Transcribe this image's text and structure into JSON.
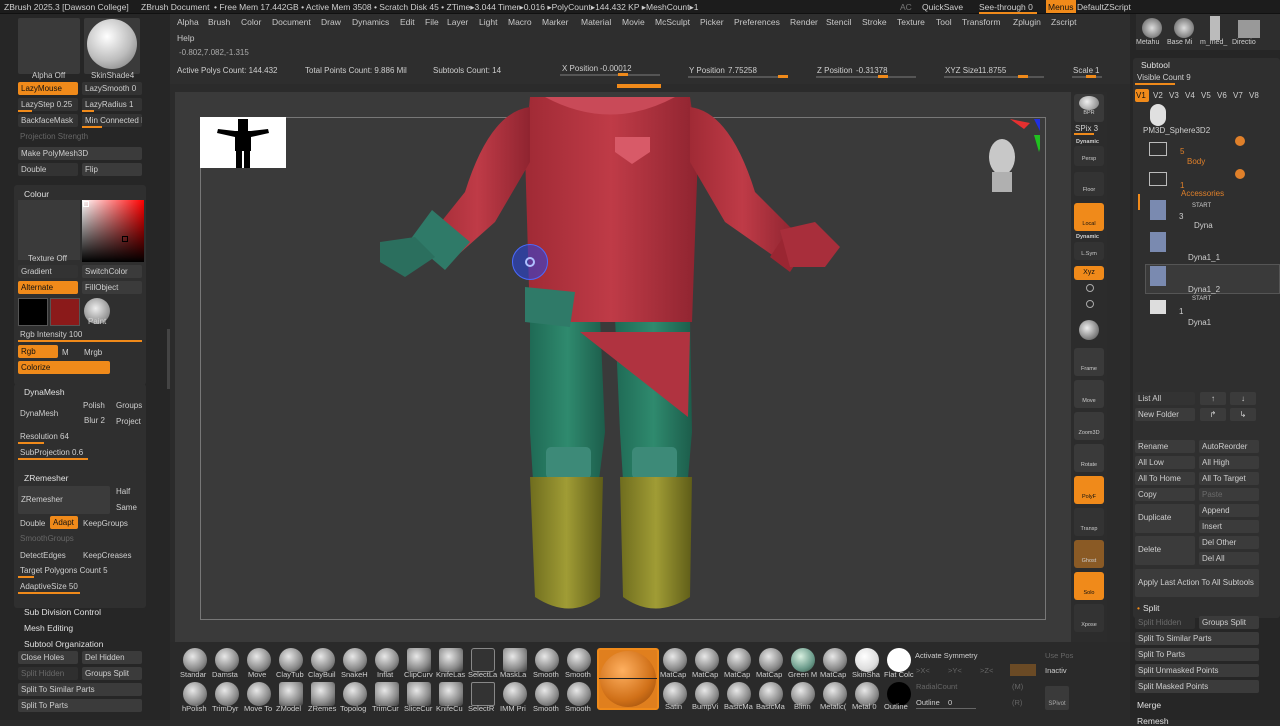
{
  "window": {
    "title": "ZBrush 2025.3 [Dawson College]",
    "document": "ZBrush Document",
    "status": "• Free Mem 17.442GB • Active Mem 3508 • Scratch Disk 45 • ZTime▸3.044 Timer▸0.016 ▸PolyCount▸144.432 KP ▸MeshCount▸1",
    "ac": "AC",
    "quicksave": "QuickSave",
    "see_through": "See-through  0",
    "menus": "Menus",
    "default_zscript": "DefaultZScript"
  },
  "menubar": {
    "items": [
      "Alpha",
      "Brush",
      "Color",
      "Document",
      "Draw",
      "Dynamics",
      "Edit",
      "File",
      "Layer",
      "Light",
      "Macro",
      "Marker",
      "Material",
      "Movie",
      "McSculpt",
      "Picker",
      "Preferences",
      "Render",
      "Stencil",
      "Stroke",
      "Texture",
      "Tool",
      "Transform",
      "Zplugin",
      "Zscript"
    ],
    "help": "Help",
    "coords": "-0.802,7.082,-1.315"
  },
  "infobar": {
    "active_polys": "Active Polys Count: 144.432",
    "total_points": "Total Points Count: 9.886 Mil",
    "subtools_count": "Subtools Count: 14",
    "x_label": "X Position",
    "x_value": "-0.00012",
    "y_label": "Y Position",
    "y_value": "7.75258",
    "z_label": "Z Position",
    "z_value": "-0.31378",
    "xyz_label": "XYZ Size",
    "xyz_value": "11.8755",
    "scale_label": "Scale",
    "scale_value": "1"
  },
  "left": {
    "alpha_off": "Alpha Off",
    "skinshade": "SkinShade4",
    "lazymouse": "LazyMouse",
    "lazysmooth": "LazySmooth 0",
    "lazystep": "LazyStep 0.25",
    "lazyradius": "LazyRadius 1",
    "backface": "BackfaceMask",
    "min_connected": "Min Connected I",
    "projection_strength": "Projection Strength",
    "make_polymesh": "Make PolyMesh3D",
    "double": "Double",
    "flip": "Flip",
    "colour": "Colour",
    "texture_off": "Texture Off",
    "gradient": "Gradient",
    "switchcolor": "SwitchColor",
    "alternate": "Alternate",
    "fillobject": "FillObject",
    "paint": "Paint",
    "rgb_intensity": "Rgb Intensity 100",
    "rgb": "Rgb",
    "m": "M",
    "mrgb": "Mrgb",
    "colorize": "Colorize",
    "dynamesh_hdr": "DynaMesh",
    "dynamesh_btn": "DynaMesh",
    "polish": "Polish",
    "groups": "Groups",
    "blur": "Blur 2",
    "project": "Project",
    "resolution": "Resolution 64",
    "subprojection": "SubProjection 0.6",
    "zremesher_hdr": "ZRemesher",
    "zremesher_btn": "ZRemesher",
    "half": "Half",
    "same": "Same",
    "double2": "Double",
    "adapt": "Adapt",
    "keepgroups": "KeepGroups",
    "smoothgroups": "SmoothGroups",
    "detectedges": "DetectEdges",
    "keepcreases": "KeepCreases",
    "target_polys": "Target Polygons Count 5",
    "adaptivesize": "AdaptiveSize 50",
    "subdiv_control": "Sub Division Control",
    "mesh_editing": "Mesh Editing",
    "subtool_org": "Subtool Organization",
    "close_holes": "Close Holes",
    "del_hidden": "Del Hidden",
    "split_hidden": "Split Hidden",
    "groups_split": "Groups Split",
    "split_similar": "Split To Similar Parts",
    "split_parts": "Split To Parts"
  },
  "colors": {
    "accent": "#f08a1a",
    "main_color": "#000000",
    "secondary_color": "#8b1a1a",
    "shirt": "#b8323f",
    "teal": "#2e7a68",
    "olive": "#8f8d2c"
  },
  "view_buttons": [
    "BPR",
    "SPix 3",
    "Dynamic",
    "Persp",
    "Floor",
    "Local",
    "Dynamic",
    "L.Sym",
    "Xyz",
    "",
    "",
    "",
    "Frame",
    "Move",
    "Zoom3D",
    "Rotate",
    "PolyF",
    "Transp",
    "Ghost",
    "Solo",
    "Xpose"
  ],
  "right": {
    "thumbs": [
      "Metahu",
      "Base Mi",
      "m_med_",
      "Directio"
    ],
    "subtool": "Subtool",
    "visible_count": "Visible Count 9",
    "versions": [
      "V1",
      "V2",
      "V3",
      "V4",
      "V5",
      "V6",
      "V7",
      "V8"
    ],
    "items": [
      {
        "name": "PM3D_Sphere3D2"
      },
      {
        "name": "Body",
        "count": "5"
      },
      {
        "name": "Accessories",
        "count": "1"
      },
      {
        "name": "Dyna",
        "tag": "START",
        "count": "3"
      },
      {
        "name": "Dyna1_1"
      },
      {
        "name": "Dyna1_2"
      },
      {
        "name": "Dyna1",
        "tag": "START",
        "count": "1"
      }
    ],
    "list_all": "List All",
    "new_folder": "New Folder",
    "rename": "Rename",
    "autoreorder": "AutoReorder",
    "all_low": "All Low",
    "all_high": "All High",
    "all_to_home": "All To Home",
    "all_to_target": "All To Target",
    "copy": "Copy",
    "paste": "Paste",
    "duplicate": "Duplicate",
    "append": "Append",
    "insert": "Insert",
    "delete": "Delete",
    "del_other": "Del Other",
    "del_all": "Del All",
    "apply_last": "Apply Last Action To All Subtools",
    "split": "Split",
    "split_hidden": "Split Hidden",
    "groups_split": "Groups Split",
    "split_similar": "Split To Similar Parts",
    "split_parts": "Split To Parts",
    "split_unmasked": "Split Unmasked Points",
    "split_masked": "Split Masked Points",
    "merge": "Merge",
    "remesh": "Remesh"
  },
  "bottom": {
    "row1": [
      "Standar",
      "Damsta",
      "Move",
      "ClayTub",
      "ClayBuil",
      "SnakeH",
      "Inflat",
      "ClipCurv",
      "KnifeLas",
      "SelectLa",
      "MaskLa",
      "Smooth",
      "Smooth"
    ],
    "row2": [
      "hPolish",
      "TrimDyr",
      "Move To",
      "ZModel",
      "ZRemes",
      "Topolog",
      "TrimCur",
      "SliceCur",
      "KnifeCu",
      "SelectR",
      "IMM Pri",
      "Smooth",
      "Smooth"
    ],
    "mats1": [
      "MatCap",
      "MatCap",
      "MatCap",
      "MatCap",
      "Green M",
      "MatCap",
      "SkinSha",
      "Flat Colc"
    ],
    "mats2": [
      "Satin",
      "BumpVi",
      "BasicMa",
      "BasicMa",
      "Blinn",
      "Metalic(",
      "Metal 0",
      "Outline"
    ],
    "activate_symmetry": "Activate Symmetry",
    "sym_x": ">X<",
    "sym_y": ">Y<",
    "sym_z": ">Z<",
    "m": "(M)",
    "use_pos": "Use Pos",
    "inactive": "Inactiv",
    "radial_count": "RadialCount",
    "r": "(R)",
    "outline": "Outline",
    "outline_val": "0",
    "spivot": "SPivot"
  }
}
